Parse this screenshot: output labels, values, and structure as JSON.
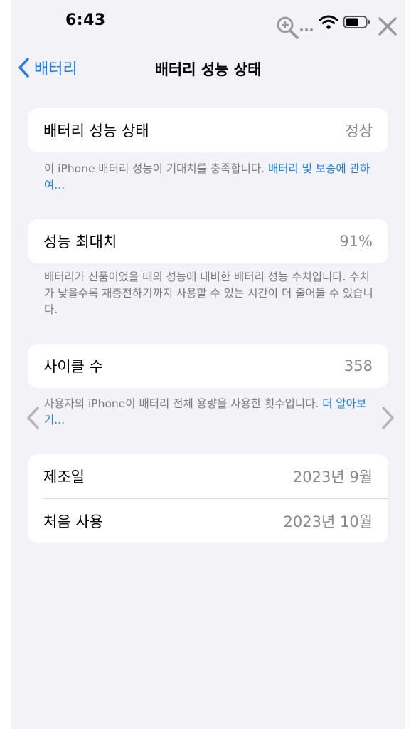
{
  "status_bar": {
    "time": "6:43",
    "icons": [
      "zoom-icon",
      "wifi-icon",
      "battery-icon",
      "close-icon"
    ]
  },
  "nav": {
    "back_label": "배터리",
    "title": "배터리 성능 상태"
  },
  "sections": {
    "health": {
      "label": "배터리 성능 상태",
      "value": "정상",
      "footnote_text": "이 iPhone 배터리 성능이 기대치를 충족합니다. ",
      "footnote_link": "배터리 및 보증에 관하여..."
    },
    "max_capacity": {
      "label": "성능 최대치",
      "value": "91%",
      "footnote_text": "배터리가 신품이었을 때의 성능에 대비한 배터리 성능 수치입니다. 수치가 낮을수록 재충전하기까지 사용할 수 있는 시간이 더 줄어들 수 있습니다."
    },
    "cycles": {
      "label": "사이클 수",
      "value": "358",
      "footnote_text": "사용자의 iPhone이 배터리 전체 용량을 사용한 횟수입니다. ",
      "footnote_link": "더 알아보기..."
    },
    "dates": {
      "manufacture_label": "제조일",
      "manufacture_value": "2023년 9월",
      "first_use_label": "처음 사용",
      "first_use_value": "2023년 10월"
    }
  },
  "colors": {
    "accent": "#1a7cf5",
    "background": "#f2f2f7",
    "card": "#ffffff",
    "secondary_text": "#8a8a8e"
  }
}
